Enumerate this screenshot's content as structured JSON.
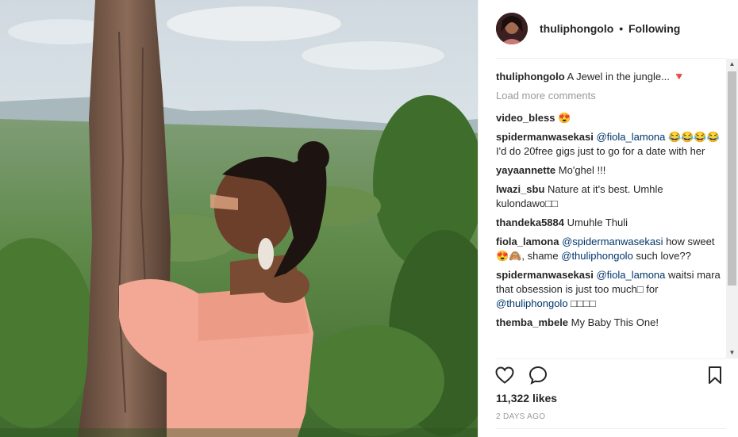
{
  "header": {
    "username": "thuliphongolo",
    "separator": "•",
    "follow_status": "Following"
  },
  "comments": [
    {
      "user": "thuliphongolo",
      "text": "A Jewel in the jungle... 🔻"
    },
    {
      "user": "video_bless",
      "text": "😍"
    },
    {
      "user": "spidermanwasekasi",
      "mention": "@fiola_lamona",
      "text": "😂😂😂😂I'd do 20free gigs just to go for a date with her"
    },
    {
      "user": "yayaannette",
      "text": "Mo'ghel !!!"
    },
    {
      "user": "lwazi_sbu",
      "text": "Nature at it's best. Umhle kulondawo□□"
    },
    {
      "user": "thandeka5884",
      "text": "Umuhle Thuli"
    },
    {
      "user": "fiola_lamona",
      "mention": "@spidermanwasekasi",
      "text": "how sweet 😍🙈, shame",
      "mention2": "@thuliphongolo",
      "text2": "such love??"
    },
    {
      "user": "spidermanwasekasi",
      "mention": "@fiola_lamona",
      "text": "waitsi mara that obsession is just too much□ for",
      "mention2": "@thuliphongolo",
      "text2": "□□□□"
    },
    {
      "user": "themba_mbele",
      "text": "My Baby This One!"
    }
  ],
  "load_more": "Load more comments",
  "likes": "11,322 likes",
  "time": "2 DAYS AGO",
  "icons": {
    "like": "heart-icon",
    "comment": "comment-icon",
    "save": "bookmark-icon"
  },
  "colors": {
    "text": "#262626",
    "mention": "#003569",
    "muted": "#999999",
    "border": "#efefef"
  }
}
